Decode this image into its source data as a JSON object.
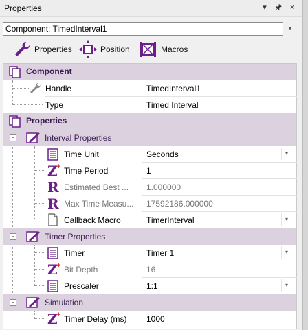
{
  "titlebar": {
    "title": "Properties",
    "pin": " ▾  ⫠",
    "close": "×"
  },
  "component_select": {
    "value": "Component: TimedInterval1",
    "arrow": "▾"
  },
  "tabs": [
    {
      "label": "Properties",
      "icon": "wrench-icon"
    },
    {
      "label": "Position",
      "icon": "move-icon"
    },
    {
      "label": "Macros",
      "icon": "macro-icon"
    }
  ],
  "sections": {
    "component": {
      "label": "Component"
    },
    "properties": {
      "label": "Properties"
    }
  },
  "rows": {
    "handle": {
      "name": "Handle",
      "value": "TimedInterval1"
    },
    "type": {
      "name": "Type",
      "value": "Timed Interval"
    },
    "interval_group": {
      "label": "Interval Properties"
    },
    "time_unit": {
      "name": "Time Unit",
      "value": "Seconds"
    },
    "time_period": {
      "name": "Time Period",
      "value": "1"
    },
    "estimated_best": {
      "name": "Estimated Best ...",
      "value": "1.000000"
    },
    "max_time": {
      "name": "Max Time Measu...",
      "value": "17592186.000000"
    },
    "callback_macro": {
      "name": "Callback Macro",
      "value": "TimerInterval"
    },
    "timer_group": {
      "label": "Timer Properties"
    },
    "timer": {
      "name": "Timer",
      "value": "Timer 1"
    },
    "bit_depth": {
      "name": "Bit Depth",
      "value": "16"
    },
    "prescaler": {
      "name": "Prescaler",
      "value": "1:1"
    },
    "simulation_group": {
      "label": "Simulation"
    },
    "timer_delay": {
      "name": "Timer Delay (ms)",
      "value": "1000"
    }
  },
  "glyphs": {
    "z": "Z",
    "r": "R",
    "minus": "−",
    "dd": "▾"
  },
  "colors": {
    "category_bg": "#dcd2df",
    "category_text": "#3d1a52",
    "icon_purple": "#6b1f8a"
  }
}
